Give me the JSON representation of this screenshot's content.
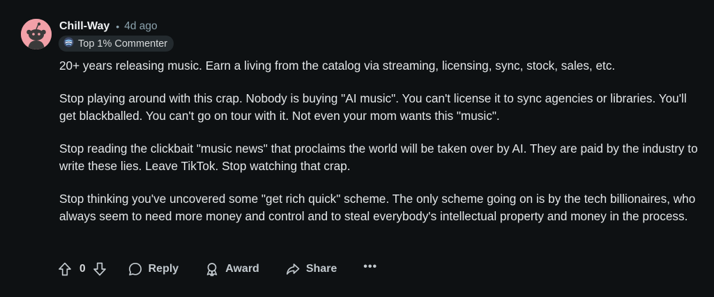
{
  "comment": {
    "author": "Chill-Way",
    "separator": "•",
    "time": "4d ago",
    "flair": {
      "label": "Top 1% Commenter",
      "icon": "top-commenter-badge-icon"
    },
    "paragraphs": [
      "20+ years releasing music. Earn a living from the catalog via streaming, licensing, sync, stock, sales, etc.",
      "Stop playing around with this crap. Nobody is buying \"AI music\". You can't license it to sync agencies or libraries. You'll get blackballed. You can't go on tour with it. Not even your mom wants this \"music\".",
      "Stop reading the clickbait \"music news\" that proclaims the world will be taken over by AI. They are paid by the industry to write these lies. Leave TikTok. Stop watching that crap.",
      "Stop thinking you've uncovered some \"get rich quick\" scheme. The only scheme going on is by the tech billionaires, who always seem to need more money and control and to steal everybody's intellectual property and money in the process."
    ]
  },
  "actions": {
    "vote_count": "0",
    "reply": "Reply",
    "award": "Award",
    "share": "Share",
    "more": "•••"
  },
  "colors": {
    "background": "#0e1113",
    "avatar": "#f2a0a8",
    "text": "#e4e7e9",
    "muted": "#8ba2ad"
  }
}
